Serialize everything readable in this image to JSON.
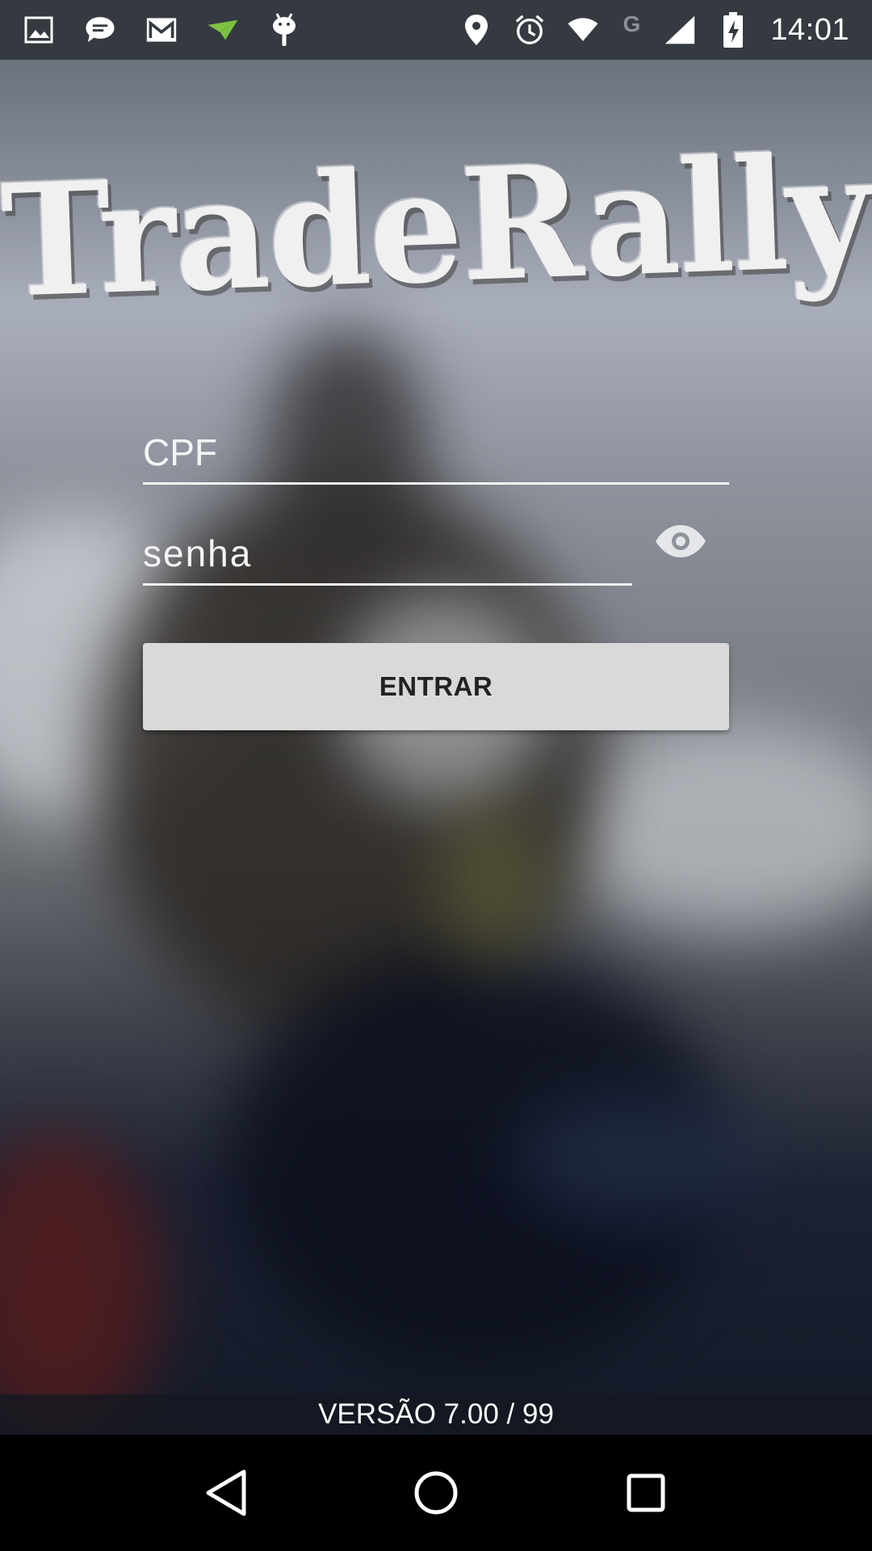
{
  "status_bar": {
    "time": "14:01",
    "left_icons": [
      "gallery-icon",
      "message-icon",
      "gmail-icon",
      "airdroid-icon",
      "android-icon"
    ],
    "right_icons": [
      "location-icon",
      "alarm-icon",
      "wifi-icon",
      "g-network-icon",
      "signal-icon",
      "battery-charging-icon"
    ],
    "network_letter": "G"
  },
  "app": {
    "logo_text": "TradeRally"
  },
  "form": {
    "cpf_placeholder": "CPF",
    "senha_placeholder": "senha",
    "show_password_icon": "eye-icon",
    "submit_label": "ENTRAR"
  },
  "footer": {
    "version": "VERSÃO 7.00 / 99"
  },
  "navigation": {
    "buttons": [
      "back-icon",
      "home-icon",
      "recents-icon"
    ]
  },
  "colors": {
    "status_bar": "#353a41",
    "button_bg": "#d9d9d9",
    "button_text": "#222222",
    "field_underline": "#f2f2f2"
  }
}
